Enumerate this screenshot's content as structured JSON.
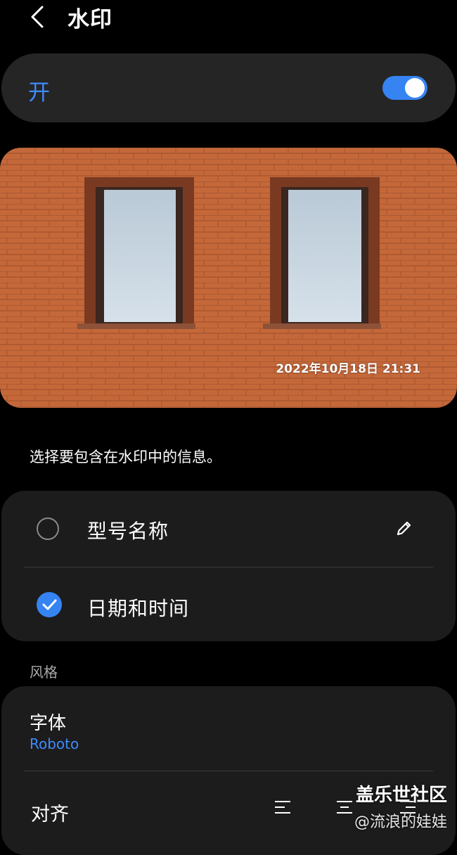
{
  "header": {
    "title": "水印"
  },
  "toggle": {
    "label": "开",
    "state": "on",
    "accent": "#3684f2"
  },
  "preview": {
    "watermark_text": "2022年10月18日 21:31"
  },
  "description": "选择要包含在水印中的信息。",
  "options": [
    {
      "label": "型号名称",
      "checked": false,
      "icon": "edit-icon"
    },
    {
      "label": "日期和时间",
      "checked": true
    }
  ],
  "style_section": {
    "label": "风格",
    "font": {
      "title": "字体",
      "value": "Roboto"
    },
    "align": {
      "title": "对齐"
    }
  },
  "overlay": {
    "line1": "盖乐世社区",
    "line2": "@流浪的娃娃"
  }
}
